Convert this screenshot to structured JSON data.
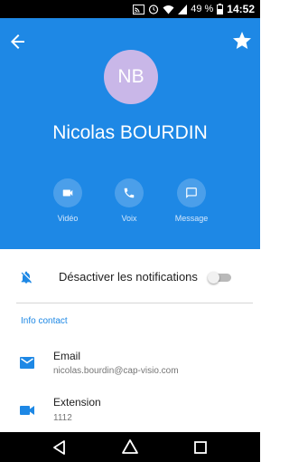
{
  "status_bar": {
    "battery_percent": "49 %",
    "time": "14:52",
    "icons": [
      "cast-icon",
      "alarm-icon",
      "wifi-icon",
      "signal-icon",
      "battery-icon"
    ]
  },
  "header": {
    "background_color": "#1e88e5",
    "avatar_initials": "NB",
    "avatar_color": "#c9b7e8",
    "contact_name": "Nicolas BOURDIN",
    "actions": [
      {
        "label": "Vidéo",
        "icon": "video-icon"
      },
      {
        "label": "Voix",
        "icon": "phone-icon"
      },
      {
        "label": "Message",
        "icon": "message-icon"
      }
    ]
  },
  "notifications": {
    "label": "Désactiver les notifications",
    "enabled": false
  },
  "info_contact": {
    "title": "Info contact",
    "items": [
      {
        "label": "Email",
        "value": "nicolas.bourdin@cap-visio.com",
        "icon": "email-icon"
      },
      {
        "label": "Extension",
        "value": "1112",
        "icon": "video-icon"
      }
    ]
  },
  "nav_bar": {
    "buttons": [
      "back-triangle-icon",
      "home-circle-icon",
      "recents-square-icon"
    ]
  }
}
